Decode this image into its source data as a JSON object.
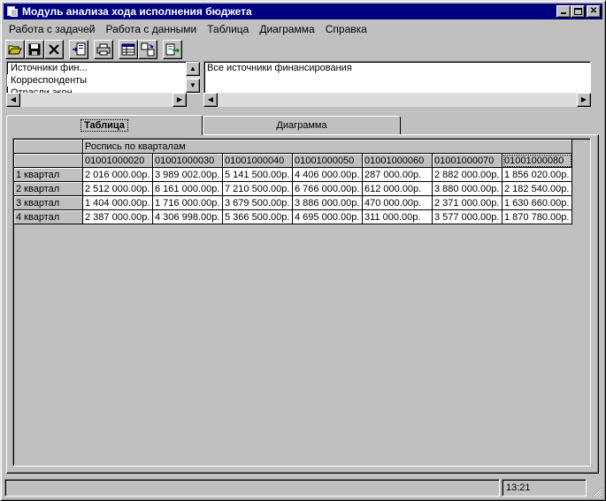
{
  "window": {
    "title": "Модуль анализа хода исполнения бюджета",
    "title_bar_color": "#000080"
  },
  "menu": [
    "Работа с задачей",
    "Работа с данными",
    "Таблица",
    "Диаграмма",
    "Справка"
  ],
  "toolbar": {
    "buttons": [
      "open-folder-icon",
      "save-icon",
      "close-x-icon",
      "import-icon",
      "print-icon",
      "table-view-icon",
      "pivot-icon",
      "export-icon"
    ]
  },
  "left_list": {
    "items": [
      "Источники фин...",
      "Корреспонденты",
      "Отрасли экон..."
    ]
  },
  "right_field": {
    "value": "Все источники финансирования"
  },
  "tabs": {
    "table": "Таблица",
    "chart": "Диаграмма"
  },
  "grid": {
    "group_header": "Роспись по кварталам",
    "columns": [
      "01001000020",
      "01001000030",
      "01001000040",
      "01001000050",
      "01001000060",
      "01001000070",
      "01001000080"
    ],
    "rows": [
      {
        "label": "1 квартал",
        "values": [
          "2 016 000.00р.",
          "3 989 002.00р.",
          "5 141 500.00р.",
          "4 406 000.00р.",
          "287 000.00р.",
          "2 882 000.00р.",
          "1 856 020.00р."
        ]
      },
      {
        "label": "2 квартал",
        "values": [
          "2 512 000.00р.",
          "6 161 000.00р.",
          "7 210 500.00р.",
          "6 766 000.00р.",
          "612 000.00р.",
          "3 880 000.00р.",
          "2 182 540.00р."
        ]
      },
      {
        "label": "3 квартал",
        "values": [
          "1 404 000.00р.",
          "1 716 000.00р.",
          "3 679 500.00р.",
          "3 886 000.00р.",
          "470 000.00р.",
          "2 371 000.00р.",
          "1 630 660.00р."
        ]
      },
      {
        "label": "4 квартал",
        "values": [
          "2 387 000.00р.",
          "4 306 998.00р.",
          "5 366 500.00р.",
          "4 695 000.00р.",
          "311 000.00р.",
          "3 577 000.00р.",
          "1 870 780.00р."
        ]
      }
    ]
  },
  "status": {
    "time": "13:21"
  }
}
